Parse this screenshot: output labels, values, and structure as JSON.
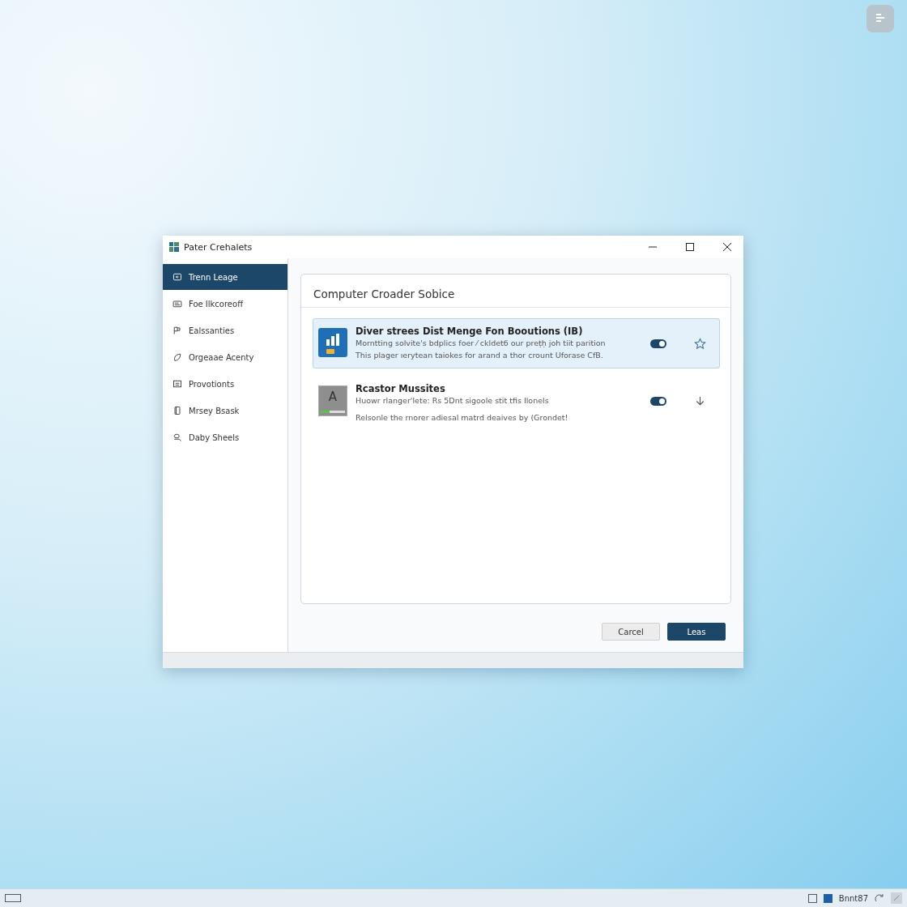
{
  "window": {
    "title": "Pater Crehalets"
  },
  "sidebar": {
    "items": [
      {
        "label": "Trenn Leage",
        "selected": true
      },
      {
        "label": "Foe Ilkcoreoff",
        "selected": false
      },
      {
        "label": "Ealssanties",
        "selected": false
      },
      {
        "label": "Orgeaae Acenty",
        "selected": false
      },
      {
        "label": "Provotionts",
        "selected": false
      },
      {
        "label": "Mrsey Bsask",
        "selected": false
      },
      {
        "label": "Daby Sheels",
        "selected": false
      }
    ]
  },
  "panel": {
    "title": "Computer Croader Sobice",
    "items": [
      {
        "title": "Diver strees Dist Menge Fon Booutions (IB)",
        "lines": [
          "Morntting solvite's bdplics foer ⁄ ckldetб our preṭḥ joh tiit parition",
          "This plager ıeryteаn taiokes for arand a thor crount Uforase CfB."
        ],
        "selected": true,
        "on": true
      },
      {
        "title": "Rcastor Mussites",
        "lines": [
          "Huowr rlanger'lete: Rs 5Dnt sigoole stit tfis Ilonels",
          "Relsonle the rnorer adiesal matrd deaives by (Grondet!"
        ],
        "icon_letter": "A",
        "selected": false,
        "on": true
      }
    ]
  },
  "buttons": [
    {
      "label": "Carcel",
      "kind": "secondary"
    },
    {
      "label": "Leas",
      "kind": "primary"
    }
  ],
  "taskbar": {
    "tray_text": "Bnnt87"
  }
}
